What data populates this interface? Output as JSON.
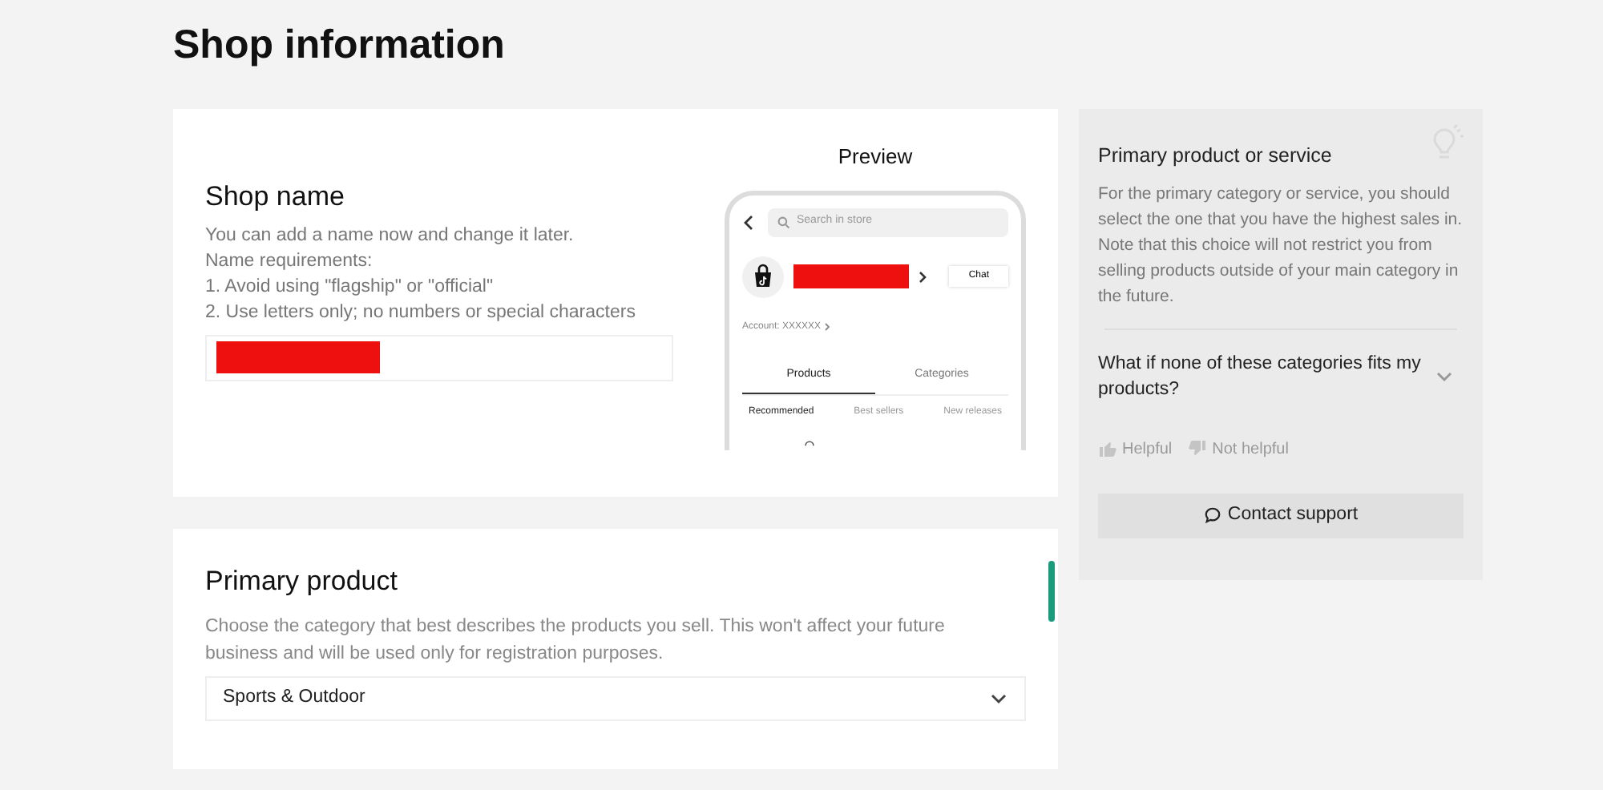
{
  "page_title": "Shop information",
  "shop_name": {
    "title": "Shop name",
    "description_lines": [
      "You can add a name now and change it later.",
      "Name requirements:",
      "1. Avoid using \"flagship\" or \"official\"",
      "2. Use letters only; no numbers or special characters"
    ],
    "value_redacted": true
  },
  "preview": {
    "title": "Preview",
    "search_placeholder": "Search in store",
    "chat_button": "Chat",
    "account": "Account: XXXXXX",
    "tabs": [
      {
        "label": "Products",
        "selected": true
      },
      {
        "label": "Categories",
        "selected": false
      }
    ],
    "filters": [
      {
        "label": "Recommended",
        "selected": true
      },
      {
        "label": "Best sellers",
        "selected": false
      },
      {
        "label": "New releases",
        "selected": false
      }
    ]
  },
  "primary_product": {
    "title": "Primary product",
    "description": "Choose the category that best describes the products you sell. This won't affect your future business and will be used only for registration purposes.",
    "value": "Sports & Outdoor"
  },
  "help_panel": {
    "title": "Primary product or service",
    "body": "For the primary category or service, you should select the one that you have the highest sales in. Note that this choice will not restrict you from selling products outside of your main category in the future.",
    "faq": [
      {
        "question": "What if none of these categories fits my products?",
        "expanded": false
      }
    ],
    "helpful": "Helpful",
    "not_helpful": "Not helpful",
    "contact_button": "Contact support"
  }
}
